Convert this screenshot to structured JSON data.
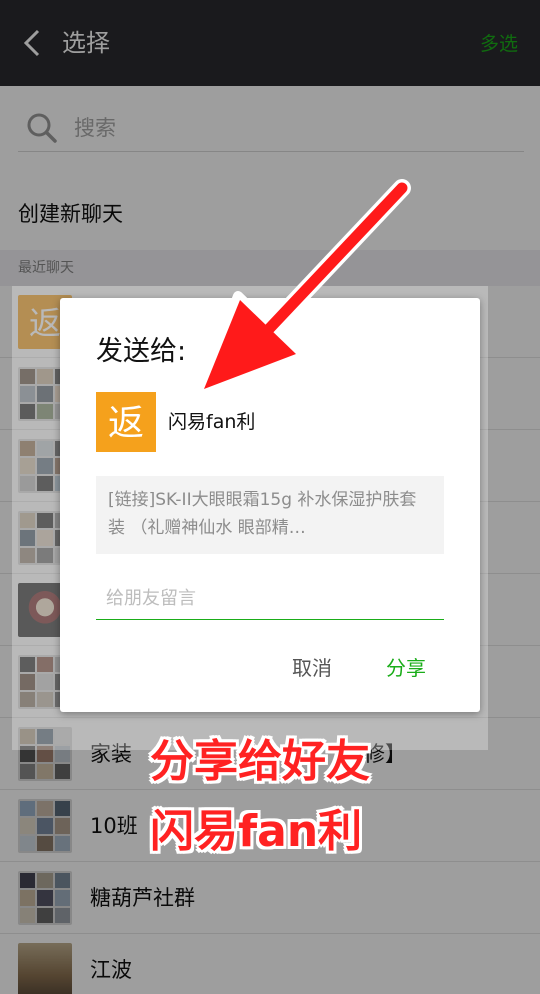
{
  "topbar": {
    "title": "选择",
    "multi_select": "多选"
  },
  "search": {
    "placeholder": "搜索"
  },
  "new_chat": {
    "label": "创建新聊天"
  },
  "recent": {
    "label": "最近聊天"
  },
  "chats": [
    {
      "name": "",
      "avatar": "app-logo"
    },
    {
      "name": "",
      "avatar": "group-grid"
    },
    {
      "name": "",
      "avatar": "group-grid"
    },
    {
      "name": "",
      "avatar": "group-grid"
    },
    {
      "name": "",
      "avatar": "group-grid"
    },
    {
      "name": "",
      "avatar": "group-grid"
    },
    {
      "name": "家装",
      "suffix": "修】",
      "avatar": "group-grid"
    },
    {
      "name": "10班",
      "avatar": "group-grid"
    },
    {
      "name": "糖葫芦社群",
      "avatar": "group-grid"
    },
    {
      "name": "江波",
      "avatar": "photo"
    }
  ],
  "dialog": {
    "title": "发送给:",
    "target_name": "闪易fan利",
    "target_logo_glyph": "返",
    "preview_text": "[链接]SK-II大眼眼霜15g 补水保湿护肤套装 （礼赠神仙水 眼部精…",
    "input_placeholder": "给朋友留言",
    "cancel_label": "取消",
    "share_label": "分享"
  },
  "annotation": {
    "line1": "分享给好友",
    "line2": "闪易fan利"
  },
  "colors": {
    "accent": "#1aad19",
    "topbar": "#2b2b2f",
    "logo_orange": "#f5a11c",
    "annotation_red": "#ff2222"
  }
}
